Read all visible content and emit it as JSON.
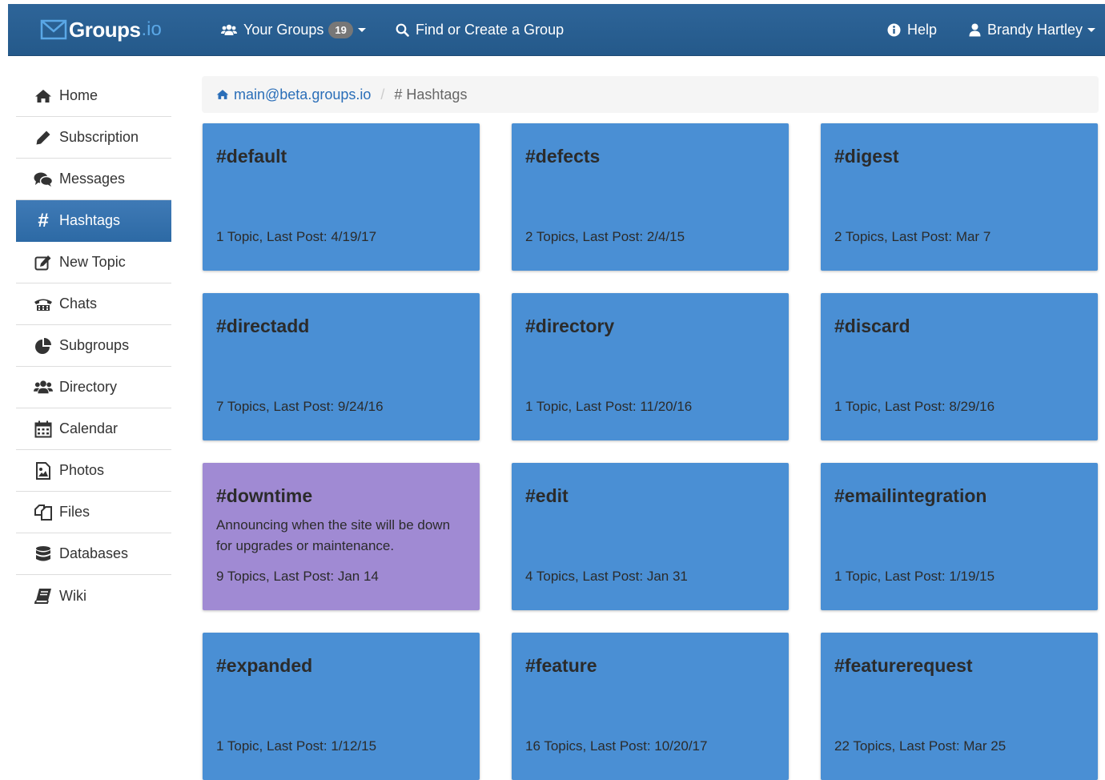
{
  "navbar": {
    "brand_name": "Groups",
    "brand_tld": ".io",
    "your_groups_label": "Your Groups",
    "your_groups_count": "19",
    "find_create_label": "Find or Create a Group",
    "help_label": "Help",
    "user_name": "Brandy Hartley"
  },
  "sidebar": {
    "items": [
      {
        "label": "Home",
        "icon": "home-icon"
      },
      {
        "label": "Subscription",
        "icon": "pencil-icon"
      },
      {
        "label": "Messages",
        "icon": "comments-icon"
      },
      {
        "label": "Hashtags",
        "icon": "hashtag-icon",
        "active": true
      },
      {
        "label": "New Topic",
        "icon": "edit-icon"
      },
      {
        "label": "Chats",
        "icon": "phone-icon"
      },
      {
        "label": "Subgroups",
        "icon": "pie-chart-icon"
      },
      {
        "label": "Directory",
        "icon": "users-icon"
      },
      {
        "label": "Calendar",
        "icon": "calendar-icon"
      },
      {
        "label": "Photos",
        "icon": "image-icon"
      },
      {
        "label": "Files",
        "icon": "files-icon"
      },
      {
        "label": "Databases",
        "icon": "database-icon"
      },
      {
        "label": "Wiki",
        "icon": "book-icon"
      }
    ]
  },
  "breadcrumb": {
    "group": "main@beta.groups.io",
    "current": "# Hashtags"
  },
  "hashtags": [
    {
      "tag": "#default",
      "meta": "1 Topic, Last Post: 4/19/17",
      "color": "#4a8fd4"
    },
    {
      "tag": "#defects",
      "meta": "2 Topics, Last Post: 2/4/15",
      "color": "#4a8fd4"
    },
    {
      "tag": "#digest",
      "meta": "2 Topics, Last Post: Mar 7",
      "color": "#4a8fd4"
    },
    {
      "tag": "#directadd",
      "meta": "7 Topics, Last Post: 9/24/16",
      "color": "#4a8fd4"
    },
    {
      "tag": "#directory",
      "meta": "1 Topic, Last Post: 11/20/16",
      "color": "#4a8fd4"
    },
    {
      "tag": "#discard",
      "meta": "1 Topic, Last Post: 8/29/16",
      "color": "#4a8fd4"
    },
    {
      "tag": "#downtime",
      "desc": "Announcing when the site will be down for upgrades or maintenance.",
      "meta": "9 Topics, Last Post: Jan 14",
      "color": "#a08ad3"
    },
    {
      "tag": "#edit",
      "meta": "4 Topics, Last Post: Jan 31",
      "color": "#4a8fd4"
    },
    {
      "tag": "#emailintegration",
      "meta": "1 Topic, Last Post: 1/19/15",
      "color": "#4a8fd4"
    },
    {
      "tag": "#expanded",
      "meta": "1 Topic, Last Post: 1/12/15",
      "color": "#4a8fd4"
    },
    {
      "tag": "#feature",
      "meta": "16 Topics, Last Post: 10/20/17",
      "color": "#4a8fd4"
    },
    {
      "tag": "#featurerequest",
      "meta": "22 Topics, Last Post: Mar 25",
      "color": "#4a8fd4"
    }
  ]
}
